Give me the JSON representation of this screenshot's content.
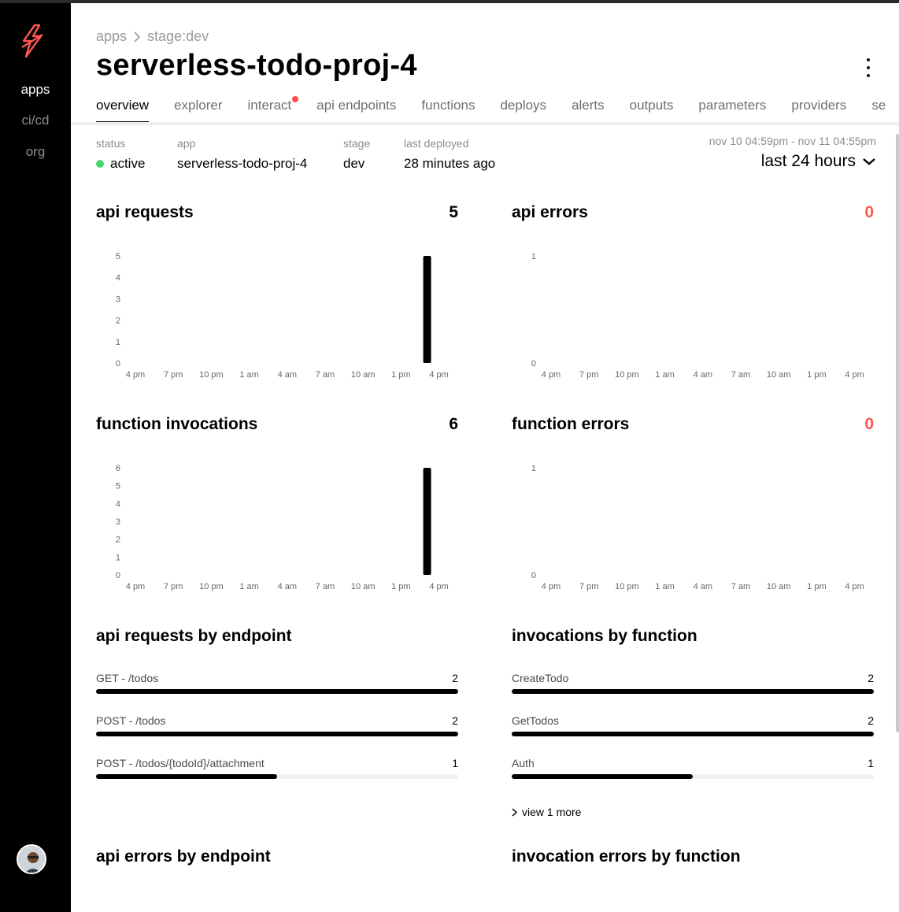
{
  "sidebar": {
    "items": [
      {
        "label": "apps",
        "active": true
      },
      {
        "label": "ci/cd",
        "active": false
      },
      {
        "label": "org",
        "active": false
      }
    ],
    "logo_color": "#fd5750"
  },
  "breadcrumb": [
    "apps",
    "stage:dev"
  ],
  "title": "serverless-todo-proj-4",
  "tabs": [
    {
      "label": "overview",
      "active": true
    },
    {
      "label": "explorer"
    },
    {
      "label": "interact",
      "dot": true
    },
    {
      "label": "api endpoints"
    },
    {
      "label": "functions"
    },
    {
      "label": "deploys"
    },
    {
      "label": "alerts"
    },
    {
      "label": "outputs"
    },
    {
      "label": "parameters"
    },
    {
      "label": "providers"
    },
    {
      "label": "se"
    }
  ],
  "stats": {
    "status": {
      "label": "status",
      "value": "active"
    },
    "app": {
      "label": "app",
      "value": "serverless-todo-proj-4"
    },
    "stage": {
      "label": "stage",
      "value": "dev"
    },
    "deployed": {
      "label": "last deployed",
      "value": "28 minutes ago"
    }
  },
  "range": {
    "dates": "nov 10 04:59pm - nov 11 04:55pm",
    "selected": "last 24 hours"
  },
  "x_ticks": [
    "4 pm",
    "7 pm",
    "10 pm",
    "1 am",
    "4 am",
    "7 am",
    "10 am",
    "1 pm",
    "4 pm"
  ],
  "chart_data": [
    {
      "type": "bar",
      "title": "api requests",
      "total": "5",
      "y_ticks": [
        "0",
        "1",
        "2",
        "3",
        "4",
        "5"
      ],
      "ylim": [
        0,
        5
      ],
      "bars": [
        {
          "x": "4 pm",
          "value": 5
        }
      ]
    },
    {
      "type": "bar",
      "title": "api errors",
      "total": "0",
      "y_ticks": [
        "0",
        "1"
      ],
      "ylim": [
        0,
        1
      ],
      "bars": []
    },
    {
      "type": "bar",
      "title": "function invocations",
      "total": "6",
      "y_ticks": [
        "0",
        "1",
        "2",
        "3",
        "4",
        "5",
        "6"
      ],
      "ylim": [
        0,
        6
      ],
      "bars": [
        {
          "x": "4 pm",
          "value": 6
        }
      ]
    },
    {
      "type": "bar",
      "title": "function errors",
      "total": "0",
      "y_ticks": [
        "0",
        "1"
      ],
      "ylim": [
        0,
        1
      ],
      "bars": []
    }
  ],
  "endpoints": {
    "title": "api requests by endpoint",
    "rows": [
      {
        "name": "GET - /todos",
        "count": "2",
        "fraction": 1.0
      },
      {
        "name": "POST - /todos",
        "count": "2",
        "fraction": 1.0
      },
      {
        "name": "POST - /todos/{todoId}/attachment",
        "count": "1",
        "fraction": 0.5
      }
    ]
  },
  "functions": {
    "title": "invocations by function",
    "rows": [
      {
        "name": "CreateTodo",
        "count": "2",
        "fraction": 1.0
      },
      {
        "name": "GetTodos",
        "count": "2",
        "fraction": 1.0
      },
      {
        "name": "Auth",
        "count": "1",
        "fraction": 0.5
      }
    ],
    "view_more": "view 1 more"
  },
  "errors_endpoint_title": "api errors by endpoint",
  "errors_function_title": "invocation errors by function"
}
